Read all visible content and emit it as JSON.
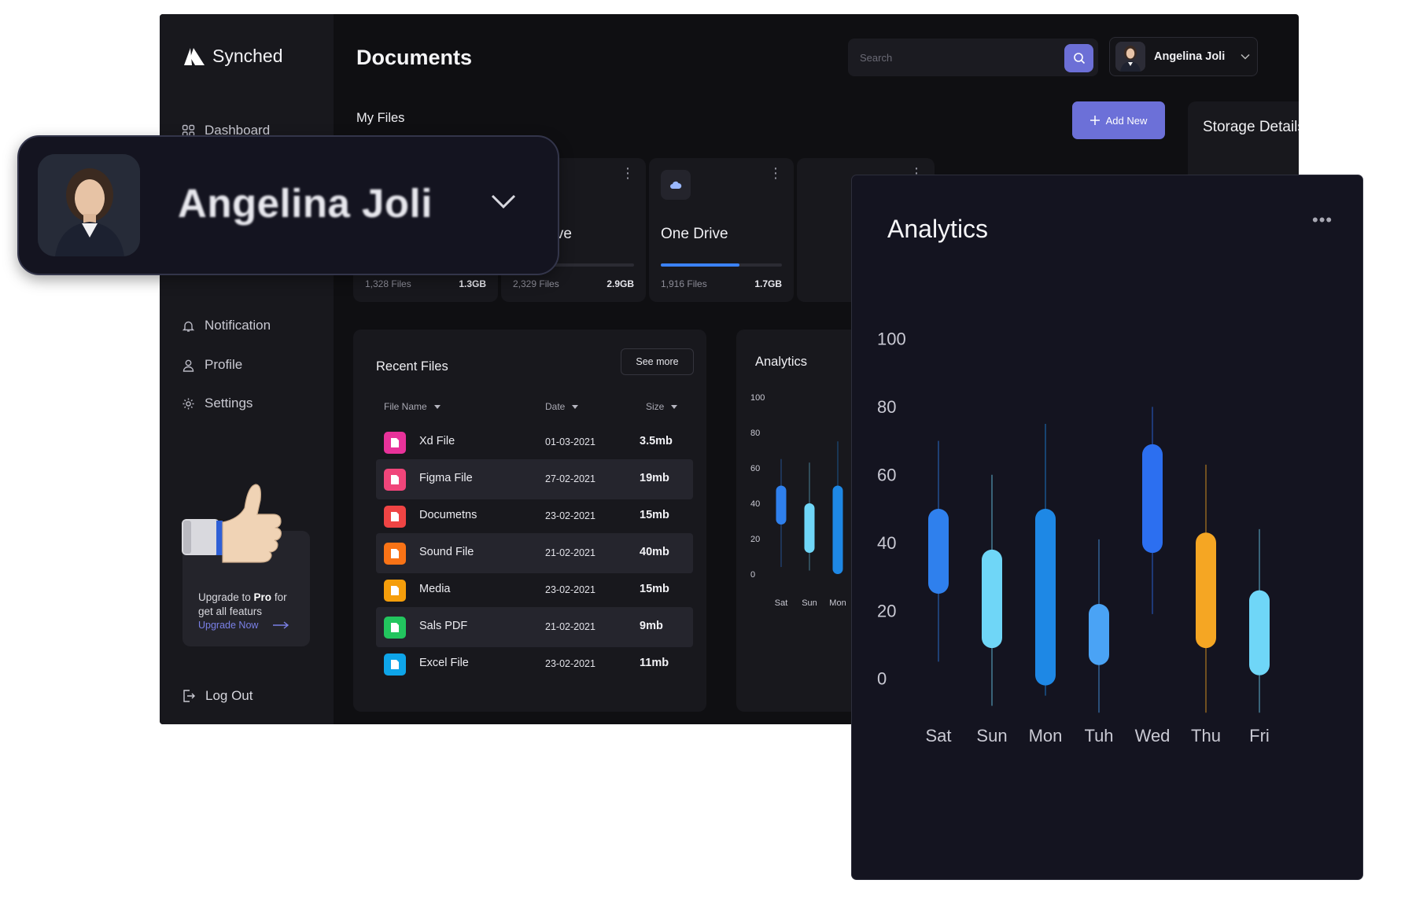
{
  "app": {
    "name": "Synched",
    "page_title": "Documents"
  },
  "sidebar": {
    "items": [
      {
        "label": "Dashboard",
        "icon": "grid-icon"
      },
      {
        "label": "Notification",
        "icon": "bell-icon"
      },
      {
        "label": "Profile",
        "icon": "user-icon"
      },
      {
        "label": "Settings",
        "icon": "gear-icon"
      }
    ],
    "upgrade": {
      "text_pre": "Upgrade to ",
      "text_bold": "Pro",
      "text_post": " for get all featurs",
      "link": "Upgrade Now"
    },
    "logout": "Log Out"
  },
  "header": {
    "search_placeholder": "Search",
    "user_name": "Angelina Joli"
  },
  "my_files": {
    "label": "My Files",
    "add_new": "Add New",
    "cards": [
      {
        "name": "",
        "files": "1,328 Files",
        "size": "1.3GB",
        "progress": 0.0,
        "color": "#3b82f6"
      },
      {
        "name": "gle Drive",
        "files": "2,329 Files",
        "size": "2.9GB",
        "progress": 0.22,
        "color": "#f59e0b"
      },
      {
        "name": "One Drive",
        "files": "1,916 Files",
        "size": "1.7GB",
        "progress": 0.65,
        "color": "#3b82f6"
      }
    ]
  },
  "storage": {
    "title": "Storage Details"
  },
  "recent_files": {
    "title": "Recent Files",
    "see_more": "See more",
    "columns": [
      "File Name",
      "Date",
      "Size"
    ],
    "rows": [
      {
        "name": "Xd File",
        "date": "01-03-2021",
        "size": "3.5mb",
        "color": "#e8329a",
        "icon": "xd-file-icon"
      },
      {
        "name": "Figma File",
        "date": "27-02-2021",
        "size": "19mb",
        "color": "#f0457a",
        "icon": "figma-file-icon"
      },
      {
        "name": "Documetns",
        "date": "23-02-2021",
        "size": "15mb",
        "color": "#ef4444",
        "icon": "document-file-icon"
      },
      {
        "name": "Sound File",
        "date": "21-02-2021",
        "size": "40mb",
        "color": "#f97316",
        "icon": "sound-file-icon"
      },
      {
        "name": "Media",
        "date": "23-02-2021",
        "size": "15mb",
        "color": "#f59e0b",
        "icon": "media-file-icon"
      },
      {
        "name": "Sals PDF",
        "date": "21-02-2021",
        "size": "9mb",
        "color": "#22c55e",
        "icon": "pdf-file-icon"
      },
      {
        "name": "Excel File",
        "date": "23-02-2021",
        "size": "11mb",
        "color": "#0ea5e9",
        "icon": "excel-file-icon"
      }
    ]
  },
  "analytics": {
    "title": "Analytics",
    "more": "•••"
  },
  "profile_popup": {
    "name": "Angelina Joli"
  },
  "chart_data": [
    {
      "type": "candlestick",
      "title": "Analytics",
      "categories": [
        "Sat",
        "Sun",
        "Mon"
      ],
      "yticks": [
        0,
        20,
        40,
        60,
        80,
        100
      ],
      "ylim": [
        0,
        100
      ],
      "candles": [
        {
          "low": 4,
          "high": 65,
          "open": 28,
          "close": 50,
          "color": "#2f80ed"
        },
        {
          "low": 2,
          "high": 63,
          "open": 12,
          "close": 40,
          "color": "#6fd6f7"
        },
        {
          "low": 0,
          "high": 75,
          "open": 0,
          "close": 50,
          "color": "#1e88e5"
        }
      ]
    },
    {
      "type": "candlestick",
      "title": "Analytics",
      "categories": [
        "Sat",
        "Sun",
        "Mon",
        "Tuh",
        "Wed",
        "Thu",
        "Fri"
      ],
      "yticks": [
        0,
        20,
        40,
        60,
        80,
        100
      ],
      "ylim": [
        0,
        100
      ],
      "candles": [
        {
          "low": 5,
          "high": 70,
          "open": 25,
          "close": 50,
          "color": "#2f80ed"
        },
        {
          "low": -8,
          "high": 60,
          "open": 9,
          "close": 38,
          "color": "#6fd6f7"
        },
        {
          "low": -5,
          "high": 75,
          "open": -2,
          "close": 50,
          "color": "#1e88e5"
        },
        {
          "low": -10,
          "high": 41,
          "open": 4,
          "close": 22,
          "color": "#4aa3f5"
        },
        {
          "low": 19,
          "high": 80,
          "open": 37,
          "close": 69,
          "color": "#2c6ff0"
        },
        {
          "low": -10,
          "high": 63,
          "open": 9,
          "close": 43,
          "color": "#f5a623"
        },
        {
          "low": -10,
          "high": 44,
          "open": 1,
          "close": 26,
          "color": "#6fd6f7"
        }
      ]
    }
  ]
}
